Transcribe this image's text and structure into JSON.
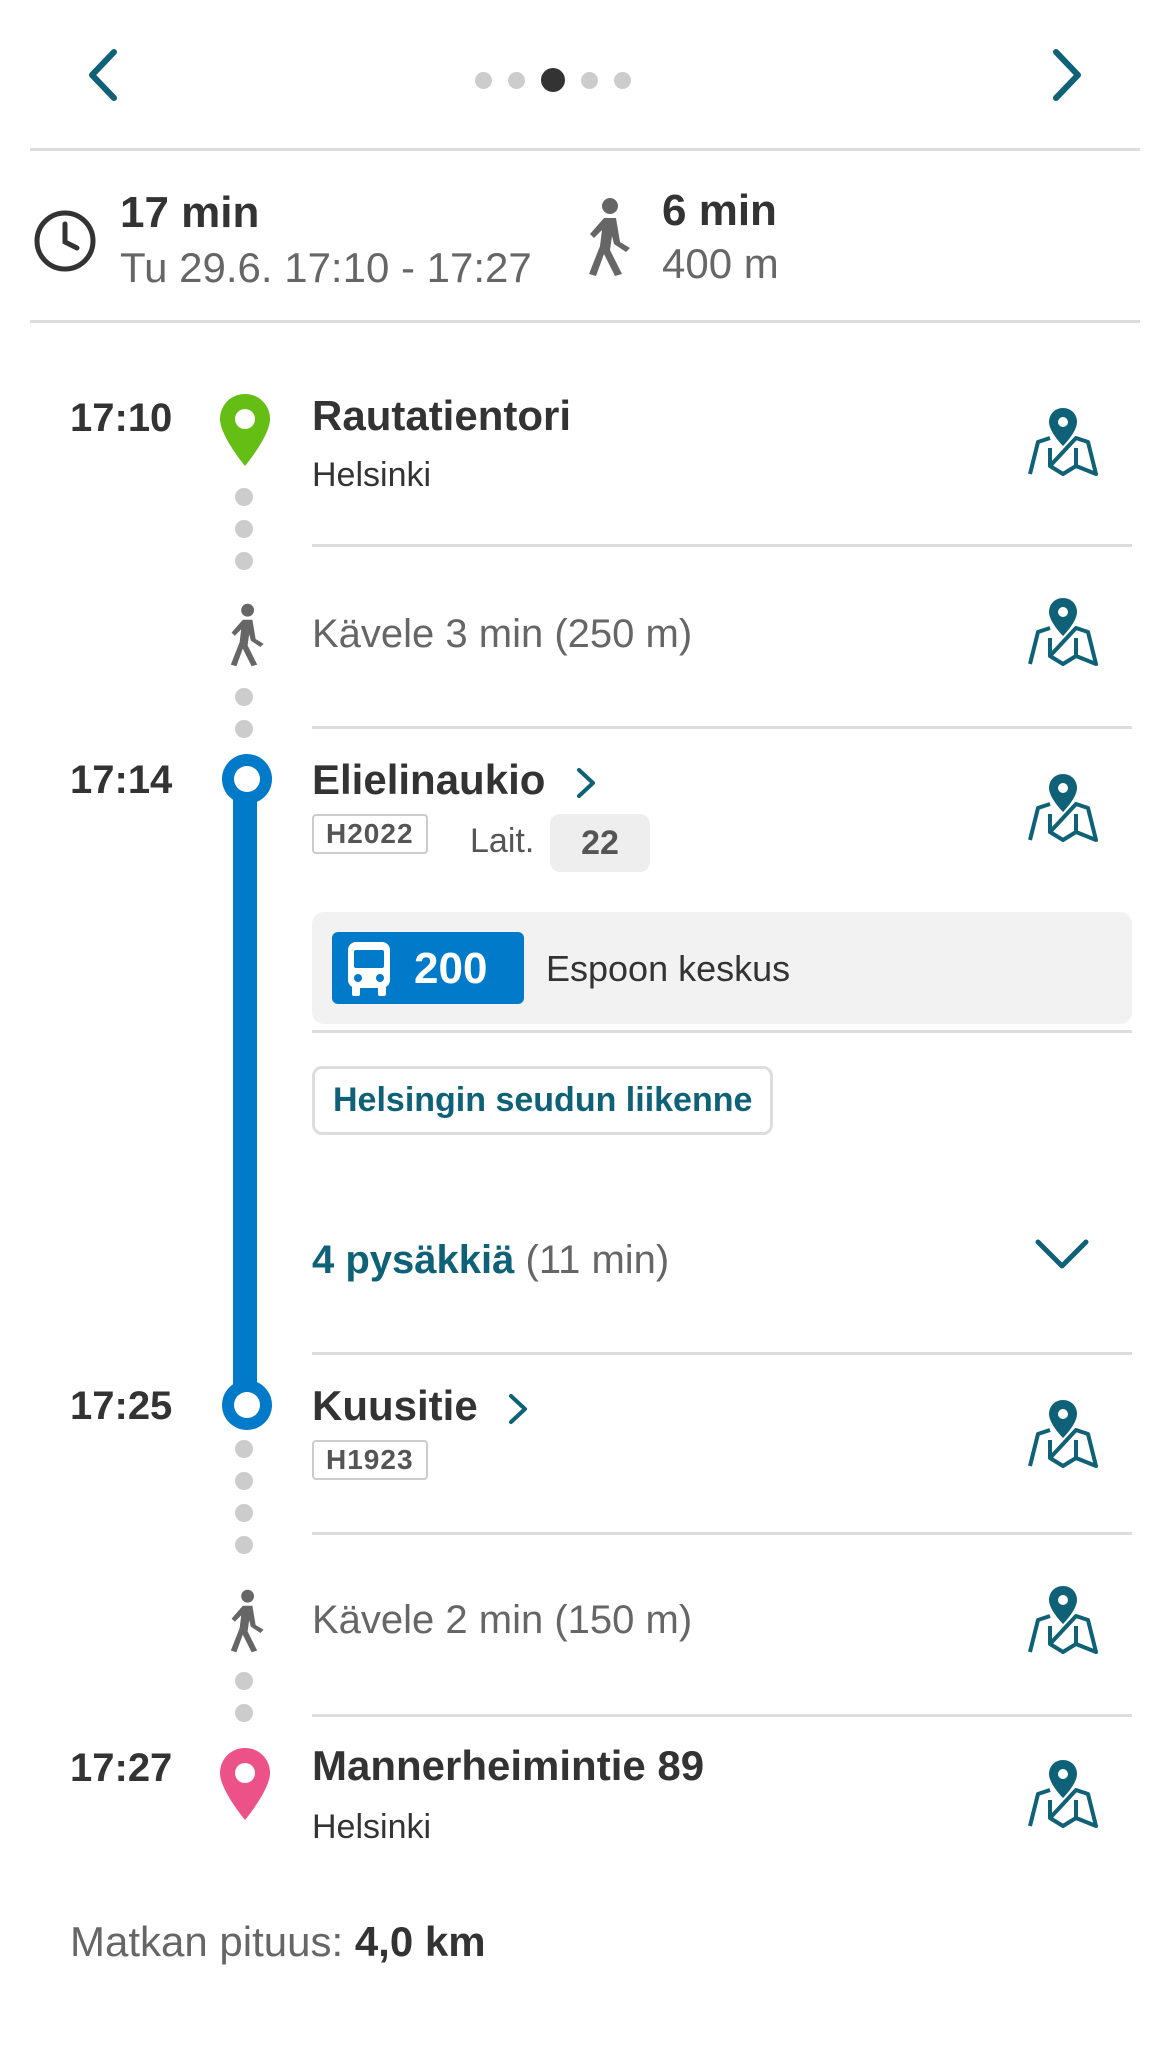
{
  "pagination": {
    "total": 5,
    "active": 3
  },
  "summary": {
    "duration": "17 min",
    "date_time": "Tu 29.6. 17:10 - 17:27",
    "walk_duration": "6 min",
    "walk_distance": "400 m"
  },
  "legs": {
    "start": {
      "time": "17:10",
      "name": "Rautatientori",
      "city": "Helsinki"
    },
    "walk1": {
      "text": "Kävele 3 min (250 m)"
    },
    "board": {
      "time": "17:14",
      "name": "Elielinaukio",
      "code": "H2022",
      "platform_label": "Lait.",
      "platform": "22"
    },
    "bus": {
      "route": "200",
      "destination": "Espoon keskus",
      "agency": "Helsingin seudun liikenne",
      "stops_strong": "4 pysäkkiä",
      "stops_duration": "(11 min)"
    },
    "alight": {
      "time": "17:25",
      "name": "Kuusitie",
      "code": "H1923"
    },
    "walk2": {
      "text": "Kävele 2 min (150 m)"
    },
    "end": {
      "time": "17:27",
      "name": "Mannerheimintie 89",
      "city": "Helsinki"
    }
  },
  "footer": {
    "label": "Matkan pituus:",
    "value": "4,0 km"
  },
  "colors": {
    "accent": "#0e6177",
    "bus": "#007ac9",
    "start": "#64be14",
    "end": "#ec5188",
    "walk": "#666666"
  }
}
